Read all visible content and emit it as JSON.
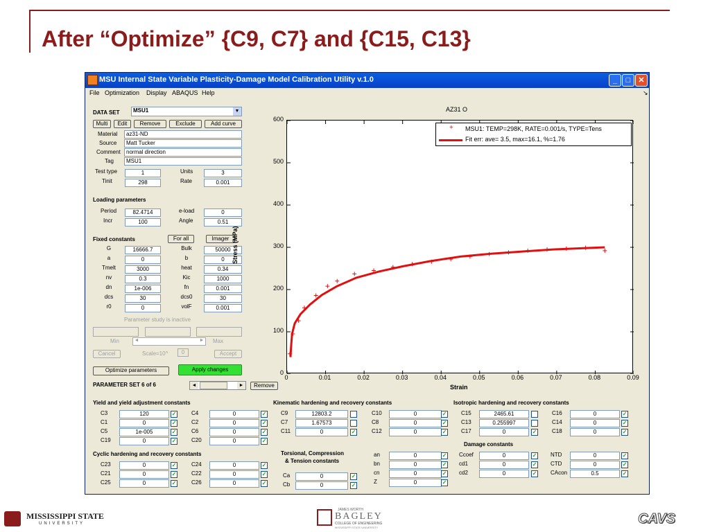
{
  "slide": {
    "title": "After “Optimize” {C9, C7} and {C15, C13}"
  },
  "window": {
    "title": "MSU Internal State Variable Plasticity-Damage Model Calibration Utility v.1.0"
  },
  "menu": [
    "File",
    "Optimization",
    "Display",
    "ABAQUS",
    "Help"
  ],
  "data_set": {
    "label": "DATA SET",
    "value": "MSU1",
    "buttons": [
      "Multi",
      "Edit",
      "Remove",
      "Exclude",
      "Add curve"
    ],
    "material_label": "Material",
    "material": "az31-ND",
    "source_label": "Source",
    "source": "Matt Tucker",
    "comment_label": "Comment",
    "comment": "normal direction",
    "tag_label": "Tag",
    "tag": "MSU1",
    "testtype_label": "Test type",
    "testtype": "1",
    "units_label": "Units",
    "units": "3",
    "tinit_label": "Tinit",
    "tinit": "298",
    "rate_label": "Rate",
    "rate": "0.001"
  },
  "loading": {
    "title": "Loading parameters",
    "period_label": "Period",
    "period": "82.4714",
    "eload_label": "e-load",
    "eload": "0",
    "incr_label": "Incr",
    "incr": "100",
    "angle_label": "Angle",
    "angle": "0.51"
  },
  "fixed": {
    "title": "Fixed constants",
    "forall": "For all",
    "imager": "Imager",
    "rows": [
      [
        "G",
        "16666.7",
        "Bulk",
        "50000"
      ],
      [
        "a",
        "0",
        "b",
        "0"
      ],
      [
        "Tmelt",
        "3000",
        "heat",
        "0.34"
      ],
      [
        "nv",
        "0.3",
        "Kic",
        "1000"
      ],
      [
        "dn",
        "1e-006",
        "fn",
        "0.001"
      ],
      [
        "dcs",
        "30",
        "dcs0",
        "30"
      ],
      [
        "r0",
        "0",
        "volF",
        "0.001"
      ]
    ]
  },
  "param_study": {
    "status": "Parameter study is inactive",
    "min": "Min",
    "max": "Max",
    "cancel": "Cancel",
    "scale": "Scale=10^",
    "scale_val": "0",
    "accept": "Accept"
  },
  "actions": {
    "optimize": "Optimize parameters",
    "apply": "Apply changes",
    "paramset": "PARAMETER SET 6 of 6",
    "remove": "Remove"
  },
  "groups": {
    "yield": {
      "title": "Yield and yield adjustment constants",
      "rows": [
        [
          "C3",
          "120",
          true,
          "C4",
          "0",
          true
        ],
        [
          "C1",
          "0",
          true,
          "C2",
          "0",
          true
        ],
        [
          "C5",
          "1e-005",
          true,
          "C6",
          "0",
          true
        ],
        [
          "C19",
          "0",
          true,
          "C20",
          "0",
          true
        ]
      ]
    },
    "cyclic": {
      "title": "Cyclic hardening and recovery constants",
      "rows": [
        [
          "C23",
          "0",
          true,
          "C24",
          "0",
          true
        ],
        [
          "C21",
          "0",
          true,
          "C22",
          "0",
          true
        ],
        [
          "C25",
          "0",
          true,
          "C26",
          "0",
          true
        ]
      ]
    },
    "kinematic": {
      "title": "Kinematic hardening and recovery constants",
      "rows": [
        [
          "C9",
          "12803.2",
          false,
          "C10",
          "0",
          true
        ],
        [
          "C7",
          "1.67573",
          false,
          "C8",
          "0",
          true
        ],
        [
          "C11",
          "0",
          true,
          "C12",
          "0",
          true
        ]
      ]
    },
    "torsion": {
      "title1": "Torsional, Compression",
      "title2": "& Tension constants",
      "rows": [
        [
          "Ca",
          "0",
          true
        ],
        [
          "Cb",
          "0",
          true
        ]
      ],
      "right": [
        [
          "an",
          "0",
          true
        ],
        [
          "bn",
          "0",
          true
        ],
        [
          "cn",
          "0",
          true
        ],
        [
          "Z",
          "0",
          true
        ]
      ]
    },
    "isotropic": {
      "title": "Isotropic hardening and recovery constants",
      "rows": [
        [
          "C15",
          "2465.61",
          false,
          "C16",
          "0",
          true
        ],
        [
          "C13",
          "0.255997",
          false,
          "C14",
          "0",
          true
        ],
        [
          "C17",
          "0",
          true,
          "C18",
          "0",
          true
        ]
      ]
    },
    "damage": {
      "title": "Damage constants",
      "rows": [
        [
          "Ccoef",
          "0",
          true,
          "NTD",
          "0",
          true
        ],
        [
          "cd1",
          "0",
          true,
          "CTD",
          "0",
          true
        ],
        [
          "cd2",
          "0",
          true,
          "CAcon",
          "0.5",
          true
        ]
      ]
    }
  },
  "chart_data": {
    "type": "line",
    "title": "AZ31 O",
    "xlabel": "Strain",
    "ylabel": "Stress (MPa)",
    "xlim": [
      0,
      0.09
    ],
    "ylim": [
      0,
      600
    ],
    "xticks": [
      "0",
      "0.01",
      "0.02",
      "0.03",
      "0.04",
      "0.05",
      "0.06",
      "0.07",
      "0.08",
      "0.09"
    ],
    "yticks": [
      "0",
      "100",
      "200",
      "300",
      "400",
      "500",
      "600"
    ],
    "legend_position": "top-right",
    "series": [
      {
        "name": "MSU1: TEMP=298K, RATE=0.001/s, TYPE=Tens",
        "style": "marker",
        "color": "#e01010",
        "x": [
          0.0007,
          0.0015,
          0.003,
          0.0045,
          0.0075,
          0.0105,
          0.013,
          0.0175,
          0.0225,
          0.0275,
          0.0325,
          0.0375,
          0.0425,
          0.0475,
          0.0525,
          0.0575,
          0.0625,
          0.0675,
          0.0725,
          0.0775,
          0.0825
        ],
        "y": [
          48,
          95,
          126,
          157,
          186,
          208,
          220,
          237,
          245,
          253,
          260,
          266,
          272,
          278,
          284,
          288,
          292,
          295,
          297,
          299,
          292
        ]
      },
      {
        "name": "Fit err: ave= 3.5, max=16.1, %=1.76",
        "style": "line",
        "color": "#e01010",
        "x": [
          0.0009,
          0.001,
          0.0013,
          0.002,
          0.0035,
          0.006,
          0.009,
          0.013,
          0.018,
          0.024,
          0.03,
          0.037,
          0.045,
          0.053,
          0.061,
          0.069,
          0.077,
          0.0825
        ],
        "y": [
          40,
          60,
          95,
          120,
          142,
          165,
          187,
          208,
          228,
          243,
          255,
          267,
          278,
          285,
          290,
          295,
          298,
          300
        ]
      }
    ]
  },
  "colors": {
    "accent": "#8a1c1c",
    "apply": "#33e033",
    "curve": "#e01010"
  },
  "footer": {
    "msu1": "MISSISSIPPI STATE",
    "msu2": "UNIVERSITY",
    "bagley1": "JAMES WORTH",
    "bagley2": "BAGLEY",
    "bagley3": "COLLEGE OF ENGINEERING",
    "bagley4": "MISSISSIPPI STATE UNIVERSITY",
    "cavs": "CAVS"
  }
}
